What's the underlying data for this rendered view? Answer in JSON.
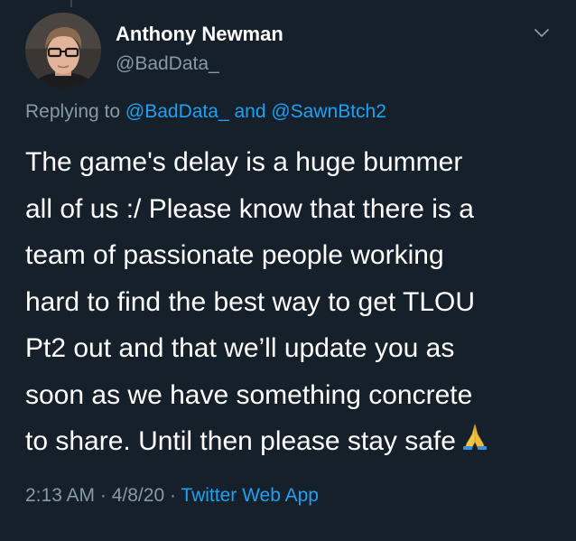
{
  "author": {
    "display_name": "Anthony Newman",
    "handle": "@BadData_",
    "avatar_icon": "profile-photo"
  },
  "menu_icon": "chevron-down-icon",
  "reply_context": {
    "prefix": "Replying to ",
    "mention_1": "@BadData_",
    "joiner": " and ",
    "mention_2": "@SawnBtch2"
  },
  "tweet_text": "The game's delay is a huge bummer\nall of us :/ Please know that there is a\nteam of passionate people working\nhard to find the best way to get TLOU\nPt2 out and that we’ll update you as\nsoon as we have something concrete\nto share. Until then please stay safe",
  "emoji": "folded-hands-icon",
  "meta": {
    "time": "2:13 AM",
    "separator_1": " · ",
    "date": "4/8/20",
    "separator_2": " · ",
    "source": "Twitter Web App"
  },
  "colors": {
    "background": "#15202b",
    "primary_text": "#ffffff",
    "secondary_text": "#8899a6",
    "link": "#1da1f2"
  }
}
